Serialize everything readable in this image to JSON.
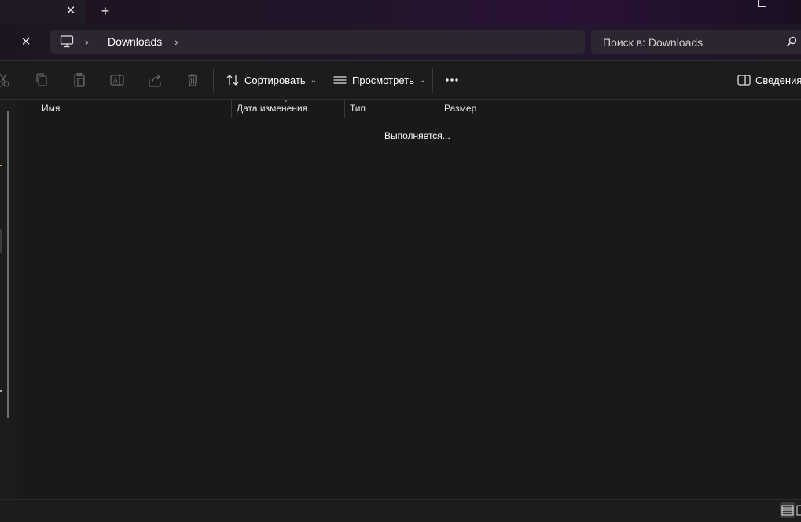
{
  "titlebar": {
    "tab_close_icon": "close-icon",
    "new_tab_icon": "plus-icon",
    "new_tab_symbol": "+",
    "close_symbol": "✕"
  },
  "address": {
    "close_symbol": "✕",
    "breadcrumb": [
      "Downloads"
    ],
    "crumb_separator": "›",
    "search_placeholder": "Поиск в: Downloads"
  },
  "toolbar": {
    "sort_label": "Сортировать",
    "view_label": "Просмотреть",
    "details_label": "Сведения",
    "chevron": "⌄",
    "disabled_icons": [
      "cut-icon",
      "copy-icon",
      "paste-icon",
      "rename-icon",
      "share-icon",
      "delete-icon"
    ]
  },
  "columns": {
    "name": "Имя",
    "modified": "Дата изменения",
    "type": "Тип",
    "size": "Размер",
    "sort_caret": "⌄"
  },
  "content": {
    "status": "Выполняется..."
  },
  "colors": {
    "background": "#1c1c1c",
    "address_bar": "#2b2630",
    "titlebar_accent": "#2a1236",
    "text": "#ffffff"
  }
}
